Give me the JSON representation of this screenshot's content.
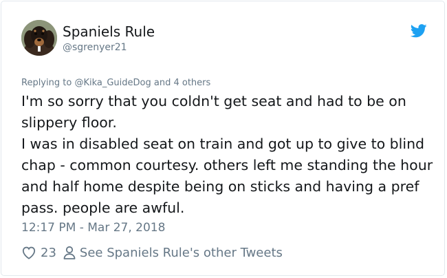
{
  "author": {
    "display_name": "Spaniels Rule",
    "handle": "@sgrenyer21",
    "avatar_icon": "dog-avatar",
    "logo_icon": "twitter-bird-icon",
    "brand_color": "#1da1f2"
  },
  "reply_context": {
    "prefix": "Replying to ",
    "mention": "@Kika_GuideDog",
    "suffix": " and 4 others"
  },
  "tweet": {
    "text": "I'm so sorry that you coldn't get  seat and had to be on slippery floor.\nI was in disabled seat on train and got up to give to blind chap - common courtesy. others left me standing the hour and half home despite being on sticks and having a pref pass. people are awful.",
    "timestamp": "12:17 PM - Mar 27, 2018"
  },
  "footer": {
    "like_icon": "heart-icon",
    "like_count": "23",
    "profile_icon": "person-icon",
    "other_tweets_label": "See Spaniels Rule's other Tweets"
  }
}
